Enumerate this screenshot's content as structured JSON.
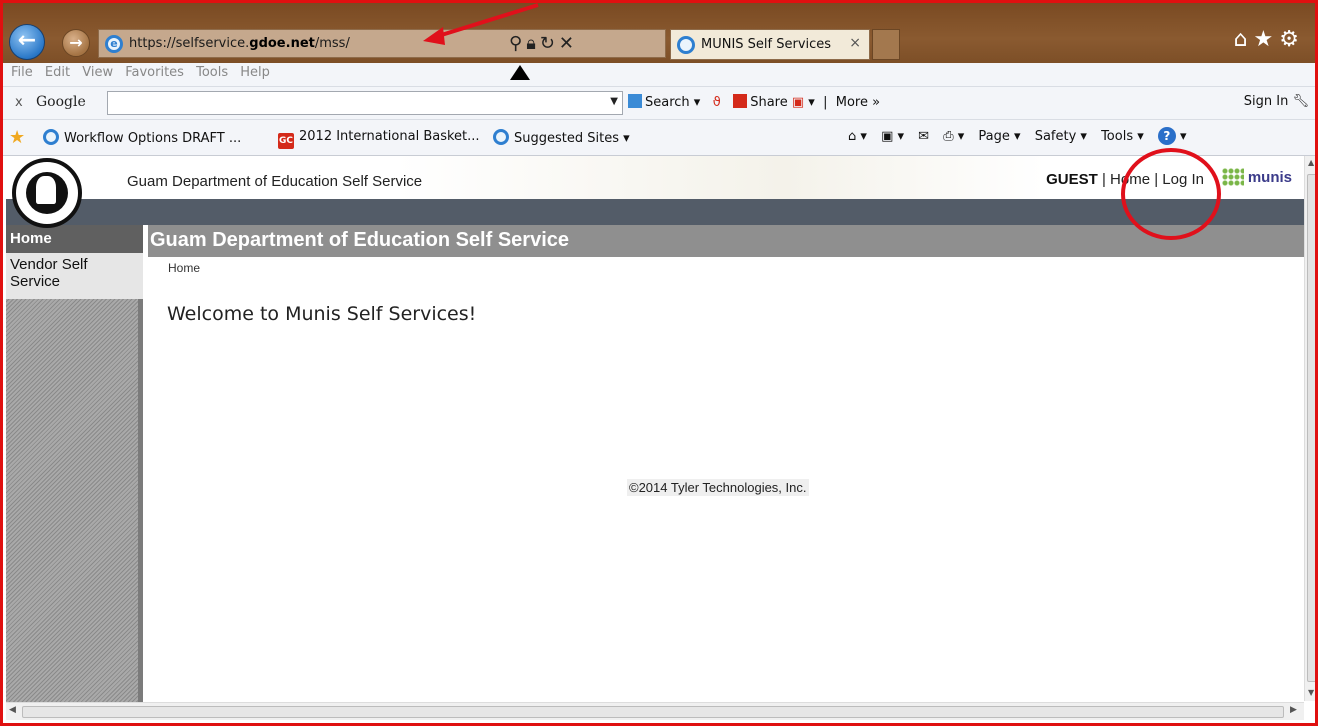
{
  "browser": {
    "url_prefix": "https://selfservice.",
    "url_host": "gdoe.net",
    "url_path": "/mss/",
    "tab_title": "MUNIS Self Services",
    "tab_close": "×",
    "menu": [
      "File",
      "Edit",
      "View",
      "Favorites",
      "Tools",
      "Help"
    ],
    "toolbar": {
      "close": "x",
      "brand": "Google",
      "search_label": "Search",
      "share_label": "Share",
      "more_label": "More »",
      "sign_in": "Sign In"
    },
    "favorites": [
      {
        "label": "Workflow Options DRAFT ...",
        "icon": "ie-icon"
      },
      {
        "label": "2012 International Basket...",
        "icon": "gc-icon"
      },
      {
        "label": "Suggested Sites ▾",
        "icon": "ie-icon"
      }
    ],
    "gc_icon_text": "GC",
    "commands": [
      "Page ▾",
      "Safety ▾",
      "Tools ▾"
    ],
    "help_icon_text": "?"
  },
  "header": {
    "title": "Guam Department of Education Self Service",
    "user": "GUEST",
    "home_link": "Home",
    "login_link": "Log In",
    "brand": "munis"
  },
  "sidebar": {
    "items": [
      {
        "label": "Home"
      },
      {
        "label": "Vendor Self Service"
      }
    ]
  },
  "main": {
    "section_title": "Guam Department of Education Self Service",
    "breadcrumb": "Home",
    "welcome": "Welcome to Munis Self Services!",
    "copyright": "©2014 Tyler Technologies, Inc."
  },
  "annotations": {
    "color": "#e0101b"
  }
}
